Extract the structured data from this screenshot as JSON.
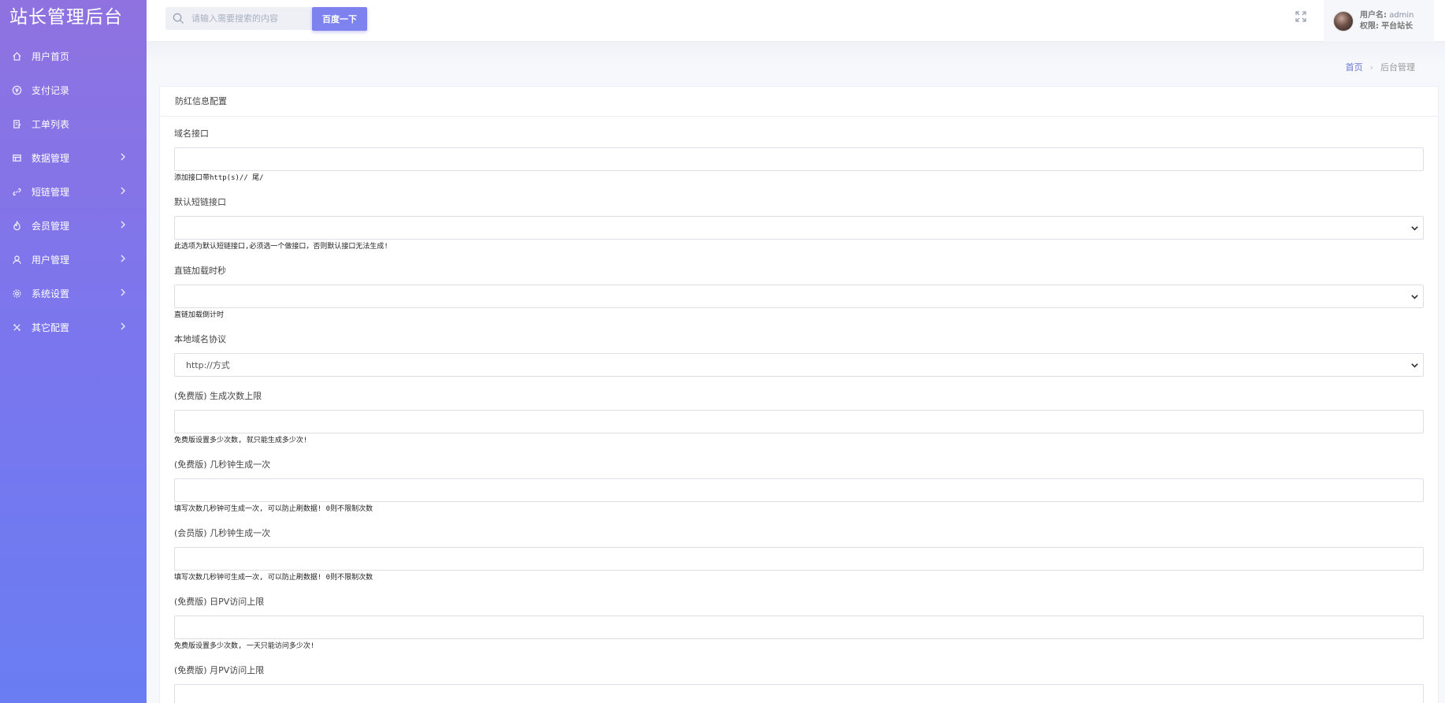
{
  "brand": "站长管理后台",
  "sidebar": {
    "items": [
      {
        "label": "用户首页",
        "icon": "home-icon",
        "has_arrow": false
      },
      {
        "label": "支付记录",
        "icon": "yuan-icon",
        "has_arrow": false
      },
      {
        "label": "工单列表",
        "icon": "ticket-icon",
        "has_arrow": false
      },
      {
        "label": "数据管理",
        "icon": "database-icon",
        "has_arrow": true
      },
      {
        "label": "短链管理",
        "icon": "link-icon",
        "has_arrow": true
      },
      {
        "label": "会员管理",
        "icon": "flame-icon",
        "has_arrow": true
      },
      {
        "label": "用户管理",
        "icon": "user-icon",
        "has_arrow": true
      },
      {
        "label": "系统设置",
        "icon": "gear-icon",
        "has_arrow": true
      },
      {
        "label": "其它配置",
        "icon": "tools-icon",
        "has_arrow": true
      }
    ]
  },
  "topbar": {
    "search_placeholder": "请输入需要搜索的内容",
    "search_button": "百度一下",
    "user_label": "用户名:",
    "user_name": "admin",
    "role_label": "权限:",
    "role_name": "平台站长"
  },
  "breadcrumb": {
    "home": "首页",
    "current": "后台管理"
  },
  "card": {
    "title": "防红信息配置"
  },
  "form": {
    "fields": [
      {
        "label": "域名接口",
        "type": "input",
        "value": "",
        "help": "添加接口带http(s)// 尾/"
      },
      {
        "label": "默认短链接口",
        "type": "select",
        "value": "",
        "help": "此选项为默认短链接口,必须选一个做接口，否则默认接口无法生成!"
      },
      {
        "label": "直链加载时秒",
        "type": "select",
        "value": "",
        "help": "直链加载倒计时"
      },
      {
        "label": "本地域名协议",
        "type": "select",
        "value": "http://方式",
        "help": ""
      },
      {
        "label": "(免费版) 生成次数上限",
        "type": "input",
        "value": "",
        "help": "免费版设置多少次数, 就只能生成多少次!"
      },
      {
        "label": "(免费版) 几秒钟生成一次",
        "type": "input",
        "value": "",
        "help": "填写次数几秒钟可生成一次, 可以防止刷数据! 0则不限制次数"
      },
      {
        "label": "(会员版) 几秒钟生成一次",
        "type": "input",
        "value": "",
        "help": "填写次数几秒钟可生成一次, 可以防止刷数据! 0则不限制次数"
      },
      {
        "label": "(免费版) 日PV访问上限",
        "type": "input",
        "value": "",
        "help": "免费版设置多少次数, 一天只能访问多少次!"
      },
      {
        "label": "(免费版) 月PV访问上限",
        "type": "input",
        "value": "",
        "help": ""
      }
    ]
  },
  "colors": {
    "sidebar_top": "#8f72e0",
    "sidebar_bottom": "#6a7df2",
    "accent": "#7e82ee"
  }
}
